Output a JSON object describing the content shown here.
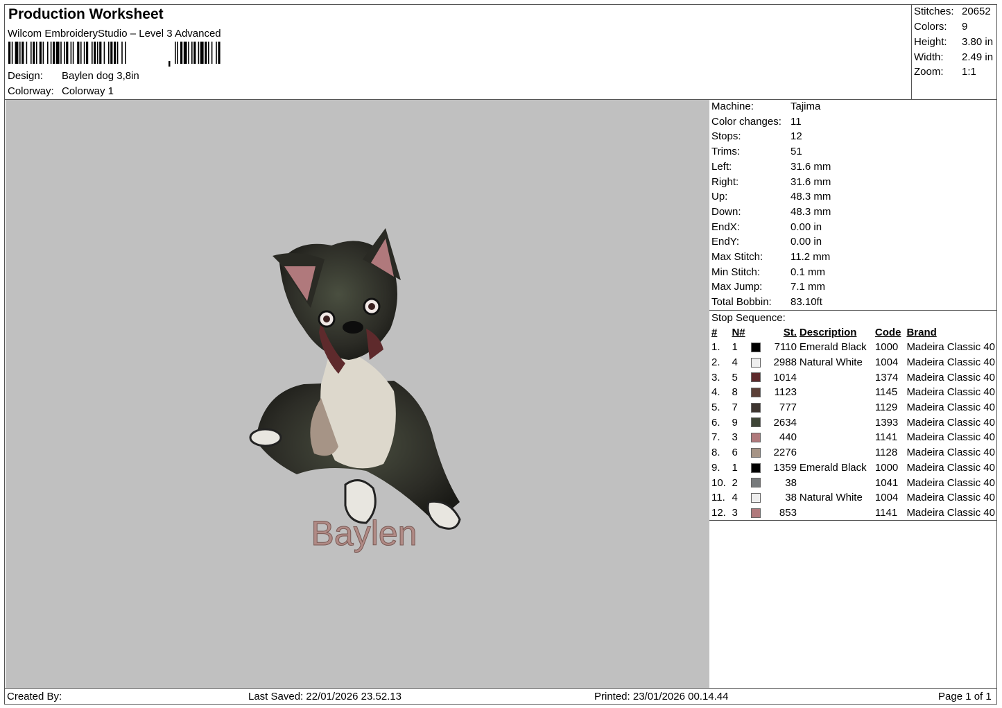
{
  "header": {
    "title": "Production Worksheet",
    "software": "Wilcom EmbroideryStudio – Level 3 Advanced",
    "design_label": "Design:",
    "design_value": "Baylen dog 3,8in",
    "colorway_label": "Colorway:",
    "colorway_value": "Colorway 1"
  },
  "summary": [
    {
      "label": "Stitches:",
      "value": "20652"
    },
    {
      "label": "Colors:",
      "value": "9"
    },
    {
      "label": "Height:",
      "value": "3.80 in"
    },
    {
      "label": "Width:",
      "value": "2.49 in"
    },
    {
      "label": "Zoom:",
      "value": "1:1"
    }
  ],
  "preview": {
    "embroidered_text": "Baylen",
    "text_color": "#b08a85",
    "background": "#c0c0c0"
  },
  "machine_info": [
    {
      "label": "Machine:",
      "value": "Tajima"
    },
    {
      "label": "Color changes:",
      "value": "11"
    },
    {
      "label": "Stops:",
      "value": "12"
    },
    {
      "label": "Trims:",
      "value": "51"
    },
    {
      "label": "Left:",
      "value": "31.6 mm"
    },
    {
      "label": "Right:",
      "value": "31.6 mm"
    },
    {
      "label": "Up:",
      "value": "48.3 mm"
    },
    {
      "label": "Down:",
      "value": "48.3 mm"
    },
    {
      "label": "EndX:",
      "value": "0.00 in"
    },
    {
      "label": "EndY:",
      "value": "0.00 in"
    },
    {
      "label": "Max Stitch:",
      "value": "11.2 mm"
    },
    {
      "label": "Min Stitch:",
      "value": "0.1 mm"
    },
    {
      "label": "Max Jump:",
      "value": "7.1 mm"
    },
    {
      "label": "Total Bobbin:",
      "value": "83.10ft"
    }
  ],
  "stop_sequence": {
    "title": "Stop Sequence:",
    "columns": [
      "#",
      "N#",
      "St.",
      "Description",
      "Code",
      "Brand"
    ],
    "rows": [
      {
        "idx": "1.",
        "n": "1",
        "color": "#000000",
        "st": "7110",
        "desc": "Emerald Black",
        "code": "1000",
        "brand": "Madeira Classic 40"
      },
      {
        "idx": "2.",
        "n": "4",
        "color": "#eeeeee",
        "st": "2988",
        "desc": "Natural White",
        "code": "1004",
        "brand": "Madeira Classic 40"
      },
      {
        "idx": "3.",
        "n": "5",
        "color": "#5e2a2c",
        "st": "1014",
        "desc": "",
        "code": "1374",
        "brand": "Madeira Classic 40"
      },
      {
        "idx": "4.",
        "n": "8",
        "color": "#5c4038",
        "st": "1123",
        "desc": "",
        "code": "1145",
        "brand": "Madeira Classic 40"
      },
      {
        "idx": "5.",
        "n": "7",
        "color": "#3e3530",
        "st": "777",
        "desc": "",
        "code": "1129",
        "brand": "Madeira Classic 40"
      },
      {
        "idx": "6.",
        "n": "9",
        "color": "#3f4537",
        "st": "2634",
        "desc": "",
        "code": "1393",
        "brand": "Madeira Classic 40"
      },
      {
        "idx": "7.",
        "n": "3",
        "color": "#b0797c",
        "st": "440",
        "desc": "",
        "code": "1141",
        "brand": "Madeira Classic 40"
      },
      {
        "idx": "8.",
        "n": "6",
        "color": "#a69486",
        "st": "2276",
        "desc": "",
        "code": "1128",
        "brand": "Madeira Classic 40"
      },
      {
        "idx": "9.",
        "n": "1",
        "color": "#000000",
        "st": "1359",
        "desc": "Emerald Black",
        "code": "1000",
        "brand": "Madeira Classic 40"
      },
      {
        "idx": "10.",
        "n": "2",
        "color": "#777a7c",
        "st": "38",
        "desc": "",
        "code": "1041",
        "brand": "Madeira Classic 40"
      },
      {
        "idx": "11.",
        "n": "4",
        "color": "#eeeeee",
        "st": "38",
        "desc": "Natural White",
        "code": "1004",
        "brand": "Madeira Classic 40"
      },
      {
        "idx": "12.",
        "n": "3",
        "color": "#b0797c",
        "st": "853",
        "desc": "",
        "code": "1141",
        "brand": "Madeira Classic 40"
      }
    ]
  },
  "footer": {
    "created_by": "Created By:",
    "last_saved": "Last Saved: 22/01/2026 23.52.13",
    "printed": "Printed: 23/01/2026 00.14.44",
    "page": "Page 1 of 1"
  }
}
